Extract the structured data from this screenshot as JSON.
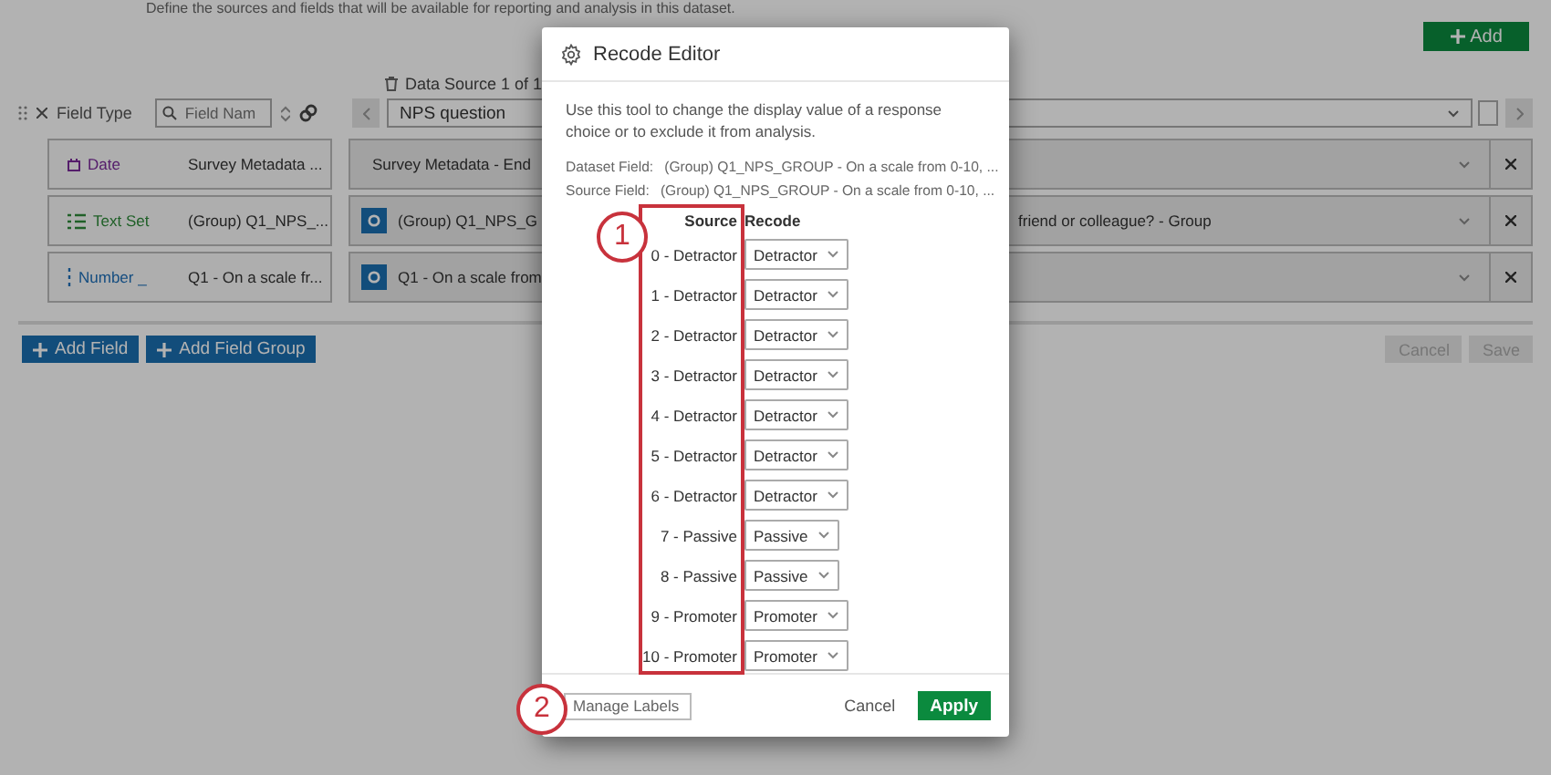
{
  "page": {
    "intro": "Define the sources and fields that will be available for reporting and analysis in this dataset.",
    "add_button": "Add"
  },
  "toolbar": {
    "field_type_label": "Field Type",
    "search": {
      "placeholder": "Field Nam"
    },
    "data_source_label": "Data Source 1 of 1",
    "data_source_value": "NPS question"
  },
  "fields": [
    {
      "kind": "date",
      "type_label": "Date",
      "name": "Survey Metadata ...",
      "source": "Survey Metadata - End",
      "has_source_icon": false
    },
    {
      "kind": "textset",
      "type_label": "Text Set",
      "name": "(Group) Q1_NPS_...",
      "source": "(Group) Q1_NPS_G",
      "source_tail": "friend or colleague? - Group",
      "has_source_icon": true
    },
    {
      "kind": "number",
      "type_label": "Number _",
      "name": "Q1 - On a scale fr...",
      "source": "Q1 - On a scale from",
      "has_source_icon": true
    }
  ],
  "actions": {
    "add_field": "Add Field",
    "add_field_group": "Add Field Group",
    "cancel": "Cancel",
    "save": "Save"
  },
  "dialog": {
    "title": "Recode Editor",
    "description": "Use this tool to change the display value of a response choice or to exclude it from analysis.",
    "dataset_field": {
      "label": "Dataset Field:",
      "value": "(Group) Q1_NPS_GROUP - On a scale from 0-10, ..."
    },
    "source_field": {
      "label": "Source Field:",
      "value": "(Group) Q1_NPS_GROUP - On a scale from 0-10, ..."
    },
    "columns": [
      "Source",
      "Recode"
    ],
    "rows": [
      {
        "source": "0 - Detractor",
        "recode": "Detractor"
      },
      {
        "source": "1 - Detractor",
        "recode": "Detractor"
      },
      {
        "source": "2 - Detractor",
        "recode": "Detractor"
      },
      {
        "source": "3 - Detractor",
        "recode": "Detractor"
      },
      {
        "source": "4 - Detractor",
        "recode": "Detractor"
      },
      {
        "source": "5 - Detractor",
        "recode": "Detractor"
      },
      {
        "source": "6 - Detractor",
        "recode": "Detractor"
      },
      {
        "source": "7 - Passive",
        "recode": "Passive"
      },
      {
        "source": "8 - Passive",
        "recode": "Passive"
      },
      {
        "source": "9 - Promoter",
        "recode": "Promoter"
      },
      {
        "source": "10 - Promoter",
        "recode": "Promoter"
      }
    ],
    "manage_labels": "Manage Labels",
    "cancel": "Cancel",
    "apply": "Apply"
  },
  "callouts": [
    "1",
    "2"
  ]
}
